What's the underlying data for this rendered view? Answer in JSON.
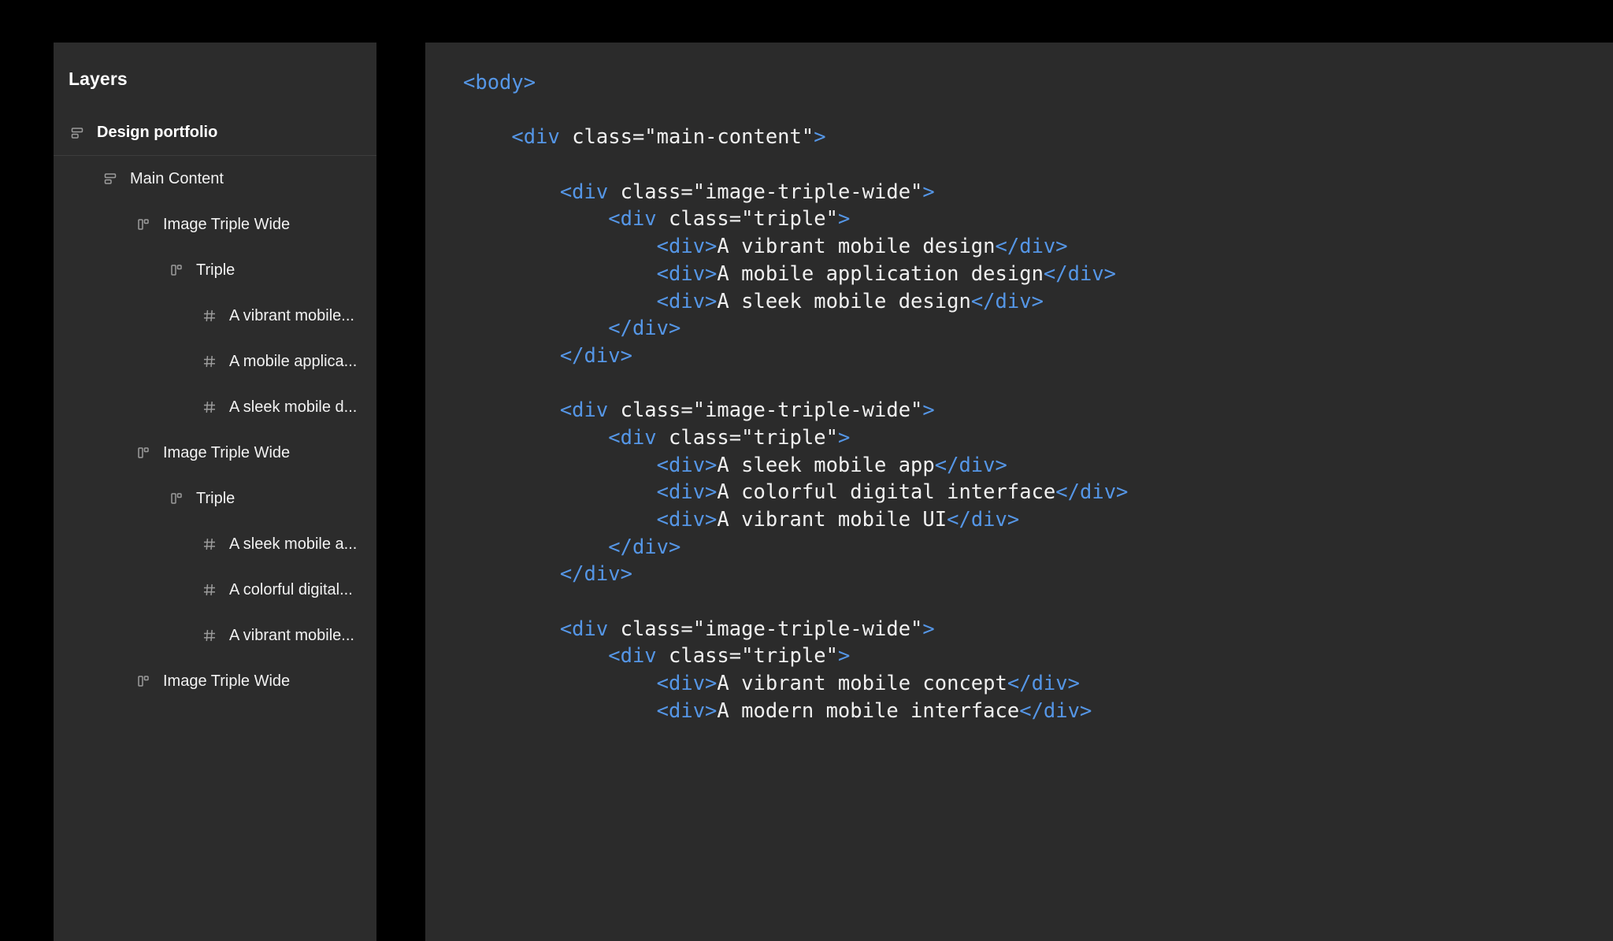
{
  "theme": {
    "page_background": "#000000",
    "panel_background": "#2c2c2c",
    "code_panel_background": "#2b2b2b",
    "tag_color": "#5596e6",
    "text_color": "#f0f0f0",
    "divider_color": "#3d3d3d"
  },
  "layers_panel": {
    "title": "Layers",
    "items": [
      {
        "label": "Design portfolio",
        "icon": "frame-icon",
        "indent": 0,
        "bold": true,
        "divider_below": true
      },
      {
        "label": "Main Content",
        "icon": "frame-icon",
        "indent": 1,
        "bold": false,
        "divider_below": false
      },
      {
        "label": "Image Triple Wide",
        "icon": "component-icon",
        "indent": 2,
        "bold": false,
        "divider_below": false
      },
      {
        "label": "Triple",
        "icon": "component-icon",
        "indent": 3,
        "bold": false,
        "divider_below": false
      },
      {
        "label": "A vibrant mobile...",
        "icon": "hash-icon",
        "indent": 4,
        "bold": false,
        "divider_below": false
      },
      {
        "label": "A mobile applica...",
        "icon": "hash-icon",
        "indent": 4,
        "bold": false,
        "divider_below": false
      },
      {
        "label": "A sleek mobile d...",
        "icon": "hash-icon",
        "indent": 4,
        "bold": false,
        "divider_below": false
      },
      {
        "label": "Image Triple Wide",
        "icon": "component-icon",
        "indent": 2,
        "bold": false,
        "divider_below": false
      },
      {
        "label": "Triple",
        "icon": "component-icon",
        "indent": 3,
        "bold": false,
        "divider_below": false
      },
      {
        "label": "A sleek mobile a...",
        "icon": "hash-icon",
        "indent": 4,
        "bold": false,
        "divider_below": false
      },
      {
        "label": "A colorful digital...",
        "icon": "hash-icon",
        "indent": 4,
        "bold": false,
        "divider_below": false
      },
      {
        "label": "A vibrant mobile...",
        "icon": "hash-icon",
        "indent": 4,
        "bold": false,
        "divider_below": false
      },
      {
        "label": "Image Triple Wide",
        "icon": "component-icon",
        "indent": 2,
        "bold": false,
        "divider_below": false
      }
    ]
  },
  "code_panel": {
    "language": "html",
    "lines": [
      [
        {
          "t": "tag",
          "v": "<body>"
        }
      ],
      [
        {
          "t": "txt",
          "v": ""
        }
      ],
      [
        {
          "t": "txt",
          "v": "    "
        },
        {
          "t": "tag",
          "v": "<div"
        },
        {
          "t": "txt",
          "v": " class=\"main-content\""
        },
        {
          "t": "tag",
          "v": ">"
        }
      ],
      [
        {
          "t": "txt",
          "v": ""
        }
      ],
      [
        {
          "t": "txt",
          "v": "        "
        },
        {
          "t": "tag",
          "v": "<div"
        },
        {
          "t": "txt",
          "v": " class=\"image-triple-wide\""
        },
        {
          "t": "tag",
          "v": ">"
        }
      ],
      [
        {
          "t": "txt",
          "v": "            "
        },
        {
          "t": "tag",
          "v": "<div"
        },
        {
          "t": "txt",
          "v": " class=\"triple\""
        },
        {
          "t": "tag",
          "v": ">"
        }
      ],
      [
        {
          "t": "txt",
          "v": "                "
        },
        {
          "t": "tag",
          "v": "<div>"
        },
        {
          "t": "txt",
          "v": "A vibrant mobile design"
        },
        {
          "t": "tag",
          "v": "</div>"
        }
      ],
      [
        {
          "t": "txt",
          "v": "                "
        },
        {
          "t": "tag",
          "v": "<div>"
        },
        {
          "t": "txt",
          "v": "A mobile application design"
        },
        {
          "t": "tag",
          "v": "</div>"
        }
      ],
      [
        {
          "t": "txt",
          "v": "                "
        },
        {
          "t": "tag",
          "v": "<div>"
        },
        {
          "t": "txt",
          "v": "A sleek mobile design"
        },
        {
          "t": "tag",
          "v": "</div>"
        }
      ],
      [
        {
          "t": "txt",
          "v": "            "
        },
        {
          "t": "tag",
          "v": "</div>"
        }
      ],
      [
        {
          "t": "txt",
          "v": "        "
        },
        {
          "t": "tag",
          "v": "</div>"
        }
      ],
      [
        {
          "t": "txt",
          "v": ""
        }
      ],
      [
        {
          "t": "txt",
          "v": "        "
        },
        {
          "t": "tag",
          "v": "<div"
        },
        {
          "t": "txt",
          "v": " class=\"image-triple-wide\""
        },
        {
          "t": "tag",
          "v": ">"
        }
      ],
      [
        {
          "t": "txt",
          "v": "            "
        },
        {
          "t": "tag",
          "v": "<div"
        },
        {
          "t": "txt",
          "v": " class=\"triple\""
        },
        {
          "t": "tag",
          "v": ">"
        }
      ],
      [
        {
          "t": "txt",
          "v": "                "
        },
        {
          "t": "tag",
          "v": "<div>"
        },
        {
          "t": "txt",
          "v": "A sleek mobile app"
        },
        {
          "t": "tag",
          "v": "</div>"
        }
      ],
      [
        {
          "t": "txt",
          "v": "                "
        },
        {
          "t": "tag",
          "v": "<div>"
        },
        {
          "t": "txt",
          "v": "A colorful digital interface"
        },
        {
          "t": "tag",
          "v": "</div>"
        }
      ],
      [
        {
          "t": "txt",
          "v": "                "
        },
        {
          "t": "tag",
          "v": "<div>"
        },
        {
          "t": "txt",
          "v": "A vibrant mobile UI"
        },
        {
          "t": "tag",
          "v": "</div>"
        }
      ],
      [
        {
          "t": "txt",
          "v": "            "
        },
        {
          "t": "tag",
          "v": "</div>"
        }
      ],
      [
        {
          "t": "txt",
          "v": "        "
        },
        {
          "t": "tag",
          "v": "</div>"
        }
      ],
      [
        {
          "t": "txt",
          "v": ""
        }
      ],
      [
        {
          "t": "txt",
          "v": "        "
        },
        {
          "t": "tag",
          "v": "<div"
        },
        {
          "t": "txt",
          "v": " class=\"image-triple-wide\""
        },
        {
          "t": "tag",
          "v": ">"
        }
      ],
      [
        {
          "t": "txt",
          "v": "            "
        },
        {
          "t": "tag",
          "v": "<div"
        },
        {
          "t": "txt",
          "v": " class=\"triple\""
        },
        {
          "t": "tag",
          "v": ">"
        }
      ],
      [
        {
          "t": "txt",
          "v": "                "
        },
        {
          "t": "tag",
          "v": "<div>"
        },
        {
          "t": "txt",
          "v": "A vibrant mobile concept"
        },
        {
          "t": "tag",
          "v": "</div>"
        }
      ],
      [
        {
          "t": "txt",
          "v": "                "
        },
        {
          "t": "tag",
          "v": "<div>"
        },
        {
          "t": "txt",
          "v": "A modern mobile interface"
        },
        {
          "t": "tag",
          "v": "</div>"
        }
      ]
    ]
  }
}
